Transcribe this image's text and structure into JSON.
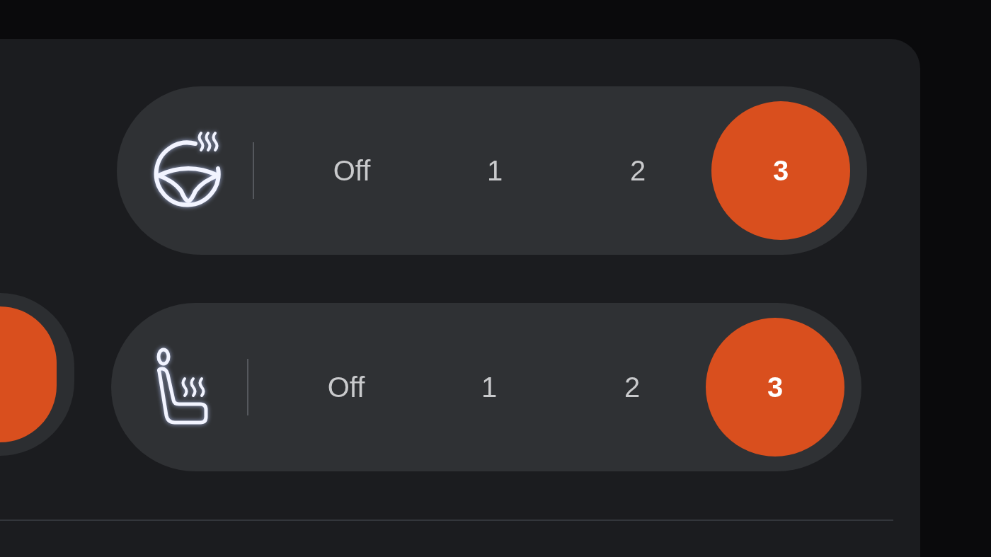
{
  "left_control": {
    "selected": true
  },
  "controls": [
    {
      "kind": "steering-wheel",
      "options": [
        {
          "label": "Off",
          "selected": false
        },
        {
          "label": "1",
          "selected": false
        },
        {
          "label": "2",
          "selected": false
        },
        {
          "label": "3",
          "selected": true
        }
      ]
    },
    {
      "kind": "seat",
      "options": [
        {
          "label": "Off",
          "selected": false
        },
        {
          "label": "1",
          "selected": false
        },
        {
          "label": "2",
          "selected": false
        },
        {
          "label": "3",
          "selected": true
        }
      ]
    }
  ]
}
